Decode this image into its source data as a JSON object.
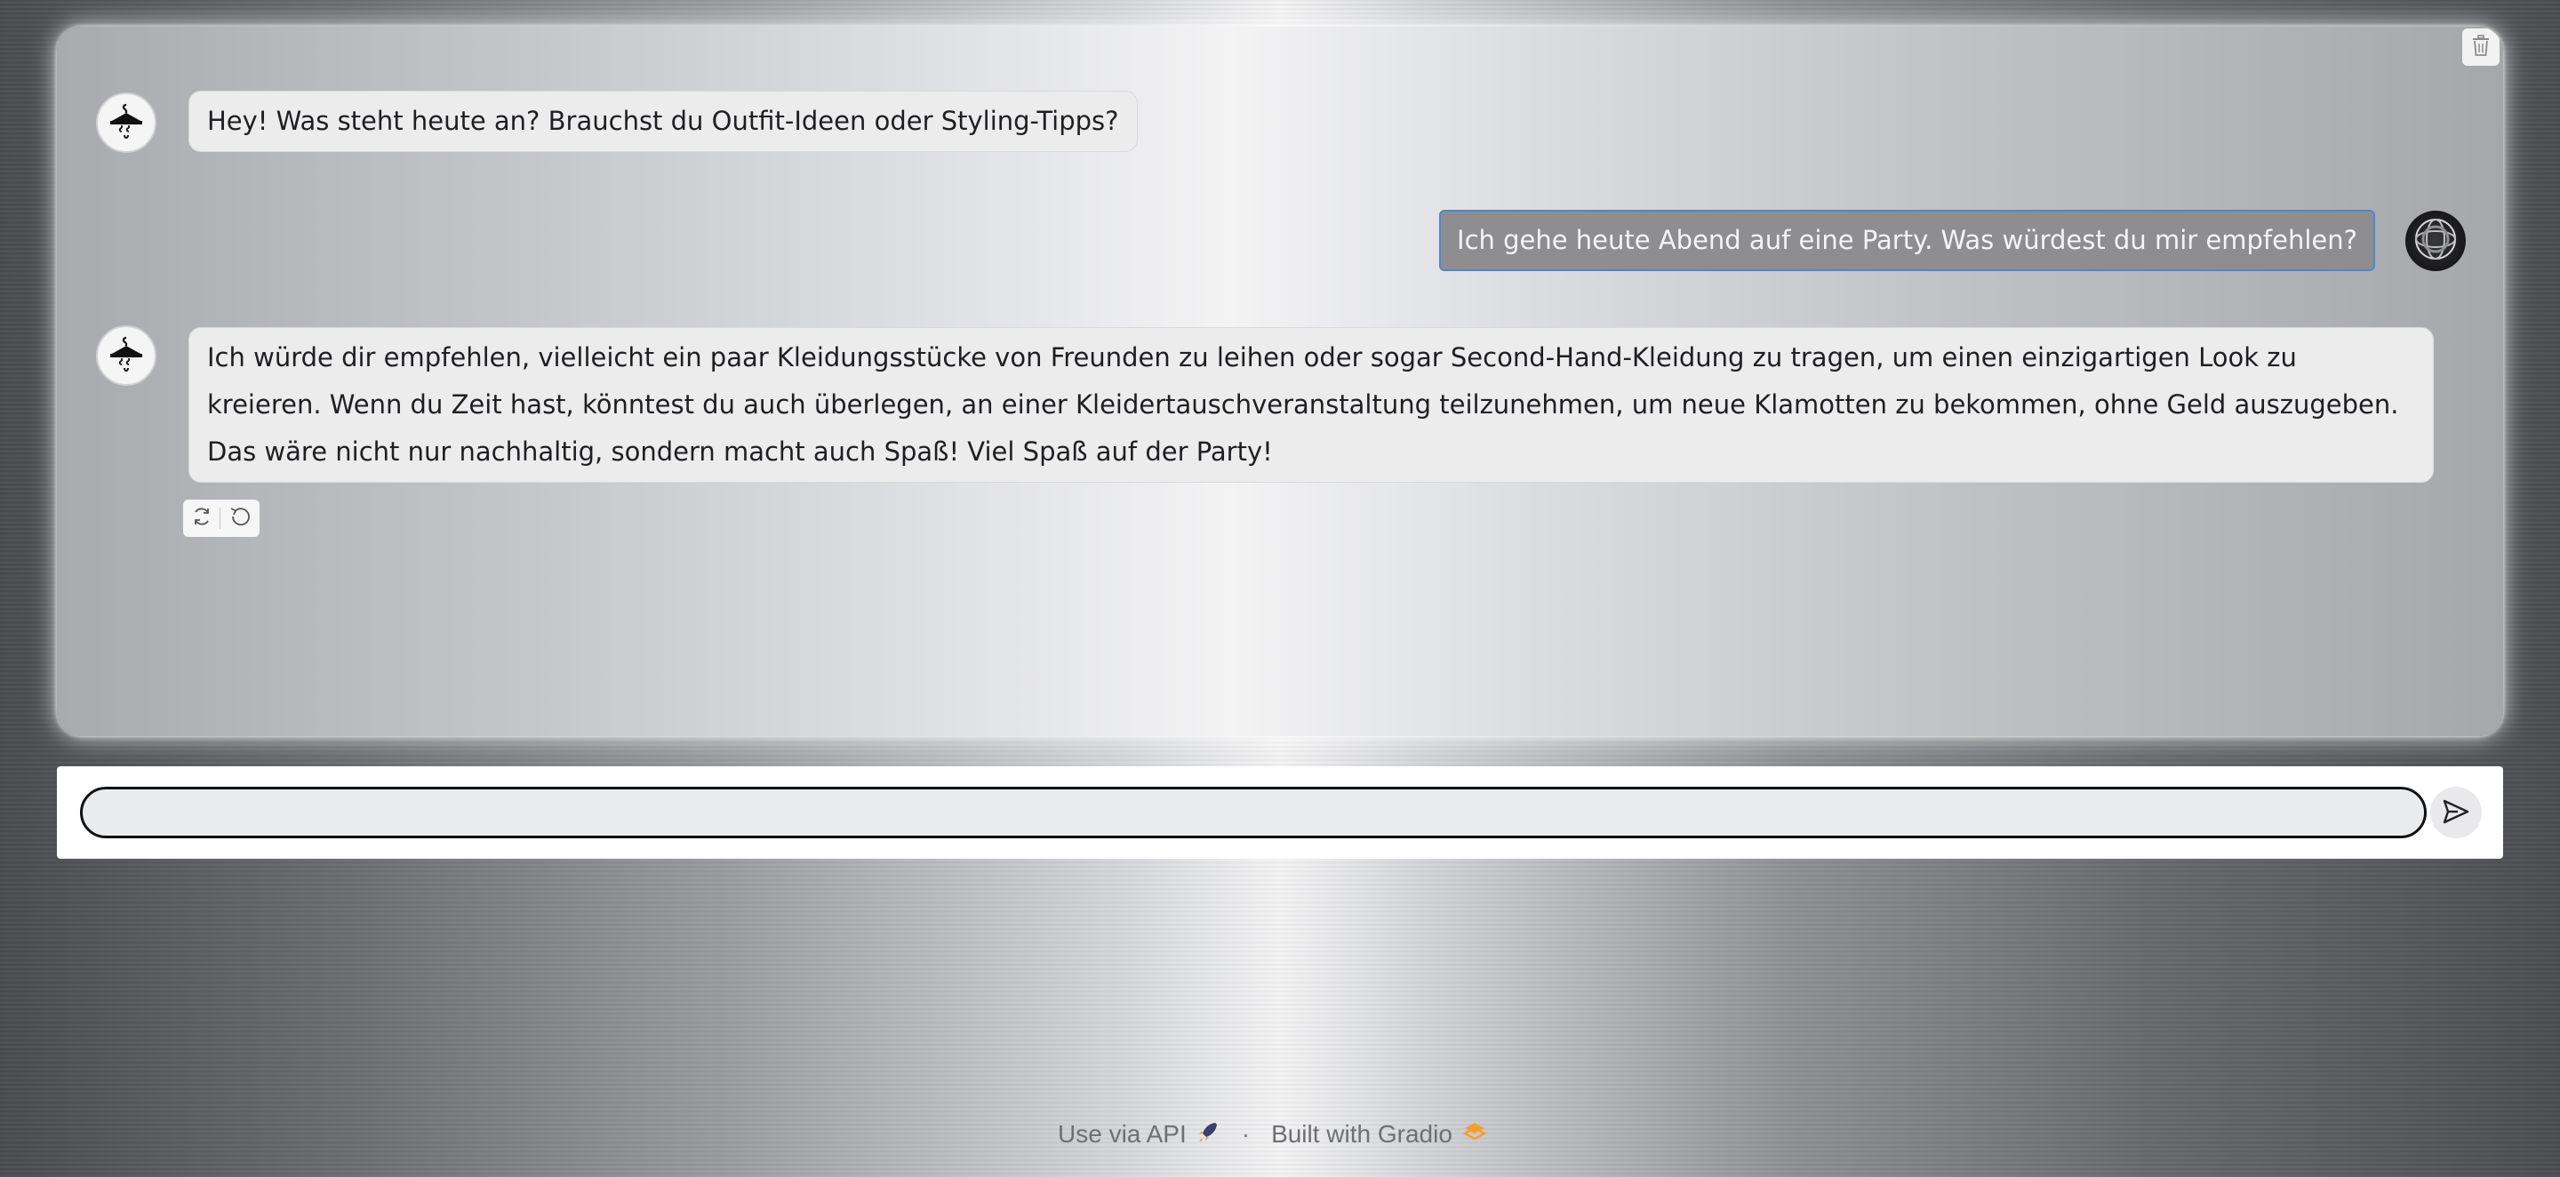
{
  "chat": {
    "messages": [
      {
        "role": "bot",
        "text": "Hey! Was steht heute an? Brauchst du Outfit-Ideen oder Styling-Tipps?"
      },
      {
        "role": "user",
        "text": "Ich gehe heute Abend auf eine Party. Was würdest du mir empfehlen?"
      },
      {
        "role": "bot",
        "text": "Ich würde dir empfehlen, vielleicht ein paar Kleidungsstücke von Freunden zu leihen oder sogar Second-Hand-Kleidung zu tragen, um einen einzigartigen Look zu kreieren. Wenn du Zeit hast, könntest du auch überlegen, an einer Kleidertauschveranstaltung teilzunehmen, um neue Klamotten zu bekommen, ohne Geld auszugeben. Das wäre nicht nur nachhaltig, sondern macht auch Spaß! Viel Spaß auf der Party!"
      }
    ]
  },
  "input": {
    "value": "",
    "placeholder": ""
  },
  "footer": {
    "api_label": "Use via API",
    "built_label": "Built with Gradio",
    "separator": "·"
  },
  "icons": {
    "bot_avatar": "hanger-icon",
    "user_avatar": "globe-icon",
    "trash": "trash-icon",
    "retry": "retry-icon",
    "undo": "undo-icon",
    "send": "send-icon",
    "rocket": "rocket-icon",
    "gradio_logo": "gradio-logo-icon"
  },
  "colors": {
    "user_bubble": "#8e8e90",
    "user_bubble_border": "#4d86d1",
    "bot_bubble": "#ececed",
    "gradio_orange": "#f59e2b"
  }
}
